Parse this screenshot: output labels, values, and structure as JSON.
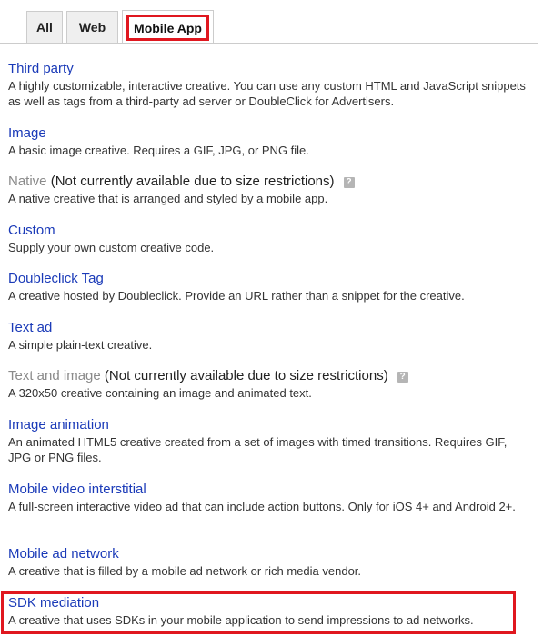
{
  "tabs": [
    {
      "label": "All"
    },
    {
      "label": "Web"
    },
    {
      "label": "Mobile App"
    }
  ],
  "items": [
    {
      "title": "Third party",
      "description": "A highly customizable, interactive creative. You can use any custom HTML and JavaScript snippets as well as tags from a third-party ad server or DoubleClick for Advertisers."
    },
    {
      "title": "Image",
      "description": "A basic image creative. Requires a GIF, JPG, or PNG file."
    },
    {
      "title": "Native",
      "note": "(Not currently available due to size restrictions)",
      "help": "?",
      "description": "A native creative that is arranged and styled by a mobile app."
    },
    {
      "title": "Custom",
      "description": "Supply your own custom creative code."
    },
    {
      "title": "Doubleclick Tag",
      "description": "A creative hosted by Doubleclick. Provide an URL rather than a snippet for the creative."
    },
    {
      "title": "Text ad",
      "description": "A simple plain-text creative."
    },
    {
      "title": "Text and image",
      "note": "(Not currently available due to size restrictions)",
      "help": "?",
      "description": "A 320x50 creative containing an image and animated text."
    },
    {
      "title": "Image animation",
      "description": "An animated HTML5 creative created from a set of images with timed transitions. Requires GIF, JPG or PNG files."
    },
    {
      "title": "Mobile video interstitial",
      "description": "A full-screen interactive video ad that can include action buttons. Only for iOS 4+ and Android 2+."
    },
    {
      "title": "Mobile ad network",
      "description": "A creative that is filled by a mobile ad network or rich media vendor."
    },
    {
      "title": "SDK mediation",
      "description": "A creative that uses SDKs in your mobile application to send impressions to ad networks."
    }
  ],
  "colors": {
    "link": "#1a3ab8",
    "disabled": "#8a8a8a",
    "highlight": "#e0171f"
  }
}
